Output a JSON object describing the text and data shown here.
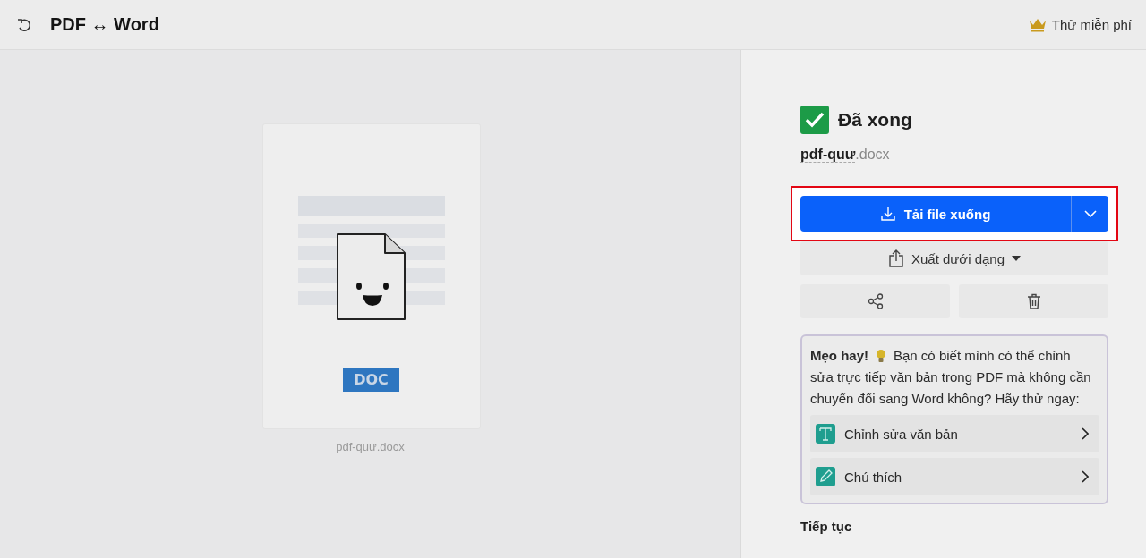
{
  "header": {
    "title": "PDF ↔ Word",
    "trial_button": "Thử miễn phí"
  },
  "preview": {
    "badge": "DOC",
    "file_name": "pdf-quư.docx"
  },
  "result": {
    "status": "Đã xong",
    "file_base": "pdf-quư",
    "file_ext": ".docx",
    "download_button": "Tải file xuống",
    "download_highlighted": true,
    "export_button": "Xuất dưới dạng"
  },
  "tip": {
    "title": "Mẹo hay!",
    "text": [
      "Bạn có biết mình có thể chỉnh",
      "sửa trực tiếp văn bản trong PDF mà không cần chuyển đổi sang Word không? Hãy thử ngay:"
    ],
    "actions": [
      {
        "kind": "edit-text",
        "label": "Chỉnh sửa văn bản"
      },
      {
        "kind": "annotate",
        "label": "Chú thích"
      }
    ]
  },
  "next_section": {
    "title": "Tiếp tục"
  }
}
